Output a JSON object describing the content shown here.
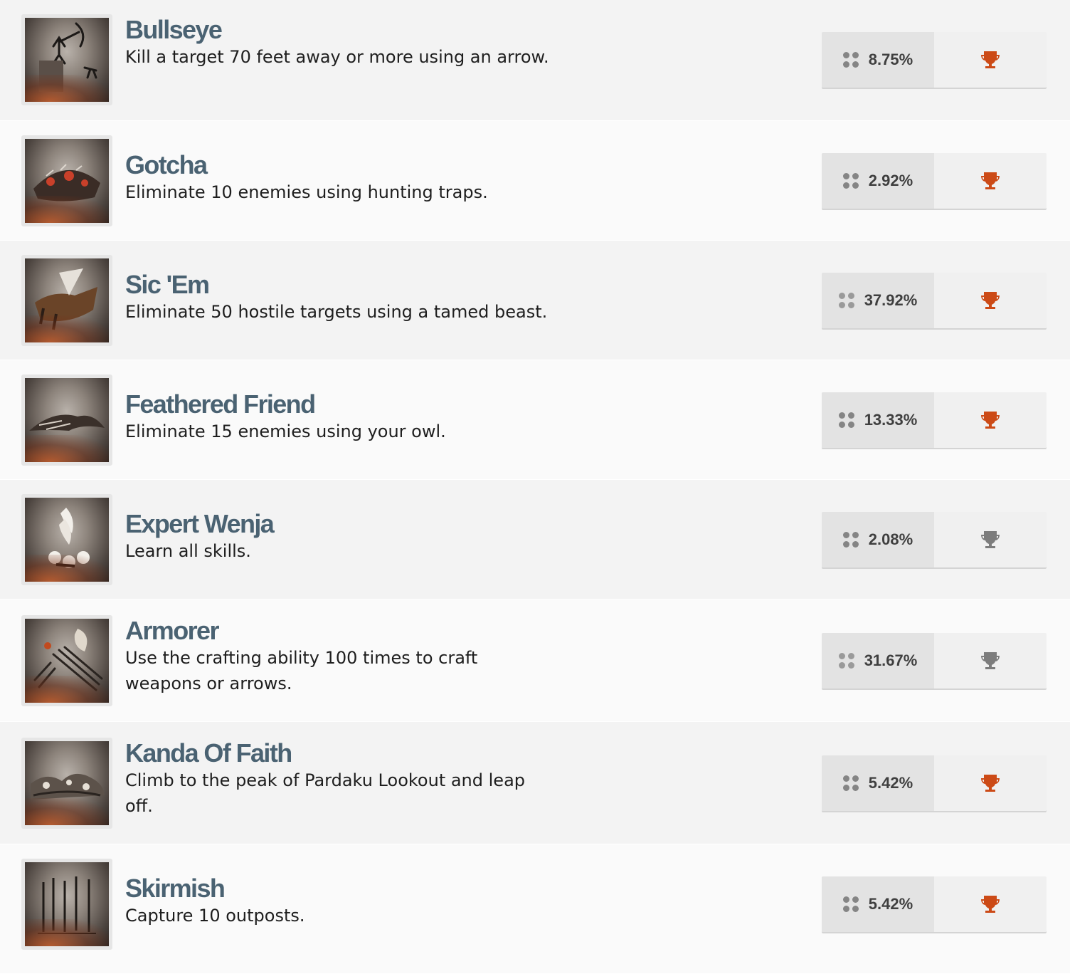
{
  "colors": {
    "title": "#4a6272",
    "trophy_unlocked": "#cc4a16",
    "trophy_locked": "#7d7d7d",
    "row_odd": "#f3f3f3",
    "row_even": "#fafafa"
  },
  "achievements": [
    {
      "title": "Bullseye",
      "description": "Kill a target 70 feet away or more using an arrow.",
      "percent": "8.75%",
      "trophy": "trophy-icon",
      "unlocked": true,
      "thumb": "archer-cave-painting"
    },
    {
      "title": "Gotcha",
      "description": "Eliminate 10 enemies using hunting traps.",
      "percent": "2.92%",
      "trophy": "trophy-icon",
      "unlocked": true,
      "thumb": "hunting-trap-painting"
    },
    {
      "title": "Sic 'Em",
      "description": "Eliminate 50 hostile targets using a tamed beast.",
      "percent": "37.92%",
      "trophy": "trophy-icon",
      "unlocked": true,
      "thumb": "beast-painting"
    },
    {
      "title": "Feathered Friend",
      "description": "Eliminate 15 enemies using your owl.",
      "percent": "13.33%",
      "trophy": "trophy-icon",
      "unlocked": true,
      "thumb": "owl-painting"
    },
    {
      "title": "Expert Wenja",
      "description": "Learn all skills.",
      "percent": "2.08%",
      "trophy": "trophy-icon",
      "unlocked": false,
      "thumb": "handprints-painting"
    },
    {
      "title": "Armorer",
      "description": "Use the crafting ability 100 times to craft weapons or arrows.",
      "percent": "31.67%",
      "trophy": "trophy-icon",
      "unlocked": false,
      "thumb": "crafting-painting"
    },
    {
      "title": "Kanda Of Faith",
      "description": "Climb to the peak of Pardaku Lookout and leap off.",
      "percent": "5.42%",
      "trophy": "trophy-icon",
      "unlocked": true,
      "thumb": "lookout-painting"
    },
    {
      "title": "Skirmish",
      "description": "Capture 10 outposts.",
      "percent": "5.42%",
      "trophy": "trophy-icon",
      "unlocked": true,
      "thumb": "outpost-painting"
    }
  ]
}
